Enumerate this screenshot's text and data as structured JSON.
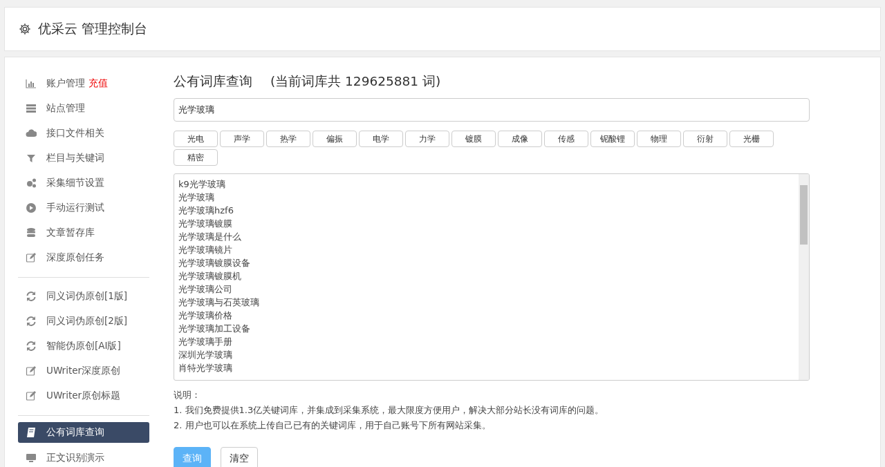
{
  "header": {
    "title": "优采云 管理控制台"
  },
  "sidebar": {
    "groups": [
      {
        "items": [
          {
            "label": "账户管理",
            "badge": "充值",
            "selected": false
          },
          {
            "label": "站点管理",
            "selected": false
          },
          {
            "label": "接口文件相关",
            "selected": false
          },
          {
            "label": "栏目与关键词",
            "selected": false
          },
          {
            "label": "采集细节设置",
            "selected": false
          },
          {
            "label": "手动运行测试",
            "selected": false
          },
          {
            "label": "文章暂存库",
            "selected": false
          },
          {
            "label": "深度原创任务",
            "selected": false
          }
        ]
      },
      {
        "items": [
          {
            "label": "同义词伪原创[1版]",
            "selected": false
          },
          {
            "label": "同义词伪原创[2版]",
            "selected": false
          },
          {
            "label": "智能伪原创[AI版]",
            "selected": false
          },
          {
            "label": "UWriter深度原创",
            "selected": false
          },
          {
            "label": "UWriter原创标题",
            "selected": false
          }
        ]
      },
      {
        "items": [
          {
            "label": "公有词库查询",
            "selected": true
          },
          {
            "label": "正文识别演示",
            "selected": false
          }
        ]
      }
    ]
  },
  "main": {
    "title": "公有词库查询",
    "subtitle": "(当前词库共 129625881 词)",
    "search": {
      "value": "光学玻璃"
    },
    "tags": [
      "光电",
      "声学",
      "热学",
      "偏振",
      "电学",
      "力学",
      "镀膜",
      "成像",
      "传感",
      "铌酸锂",
      "物理",
      "衍射",
      "光栅",
      "精密"
    ],
    "results": [
      "k9光学玻璃",
      "光学玻璃",
      "光学玻璃hzf6",
      "光学玻璃镀膜",
      "光学玻璃是什么",
      "光学玻璃镜片",
      "光学玻璃镀膜设备",
      "光学玻璃镀膜机",
      "光学玻璃公司",
      "光学玻璃与石英玻璃",
      "光学玻璃价格",
      "光学玻璃加工设备",
      "光学玻璃手册",
      "深圳光学玻璃",
      "肖特光学玻璃"
    ],
    "notes_title": "说明：",
    "notes": [
      "1. 我们免费提供1.3亿关键词库，并集成到采集系统，最大限度方便用户，解决大部分站长没有词库的问题。",
      "2. 用户也可以在系统上传自己已有的关键词库，用于自己账号下所有网站采集。"
    ],
    "buttons": [
      {
        "label": "查询",
        "kind": "primary"
      },
      {
        "label": "清空",
        "kind": "default"
      }
    ]
  }
}
